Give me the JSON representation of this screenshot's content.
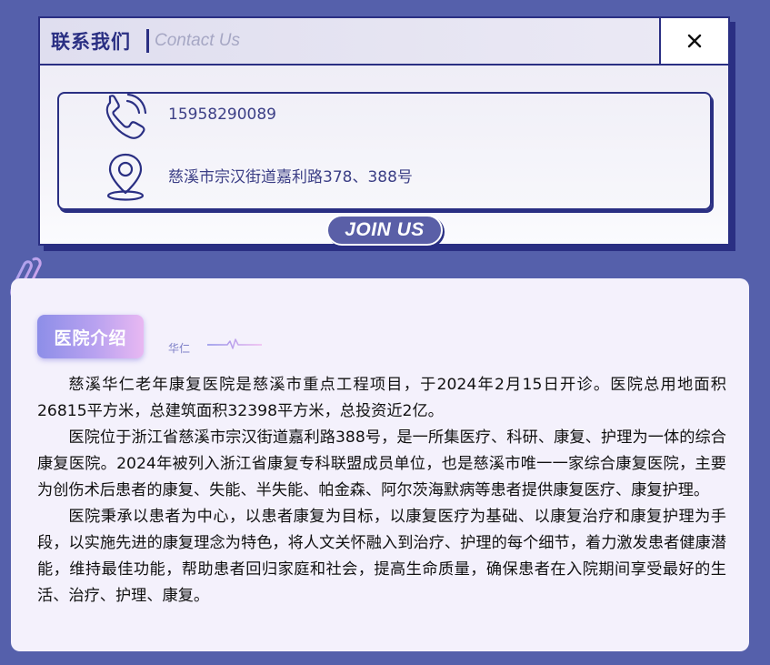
{
  "contact": {
    "title": "联系我们",
    "subtitle": "Contact Us",
    "close_label": "×",
    "phone": "15958290089",
    "address": "慈溪市宗汉街道嘉利路378、388号",
    "join_label": "JOIN US"
  },
  "intro": {
    "badge": "医院介绍",
    "small_label": "华仁",
    "paragraphs": [
      "慈溪华仁老年康复医院是慈溪市重点工程项目，于2024年2月15日开诊。医院总用地面积26815平方米，总建筑面积32398平方米，总投资近2亿。",
      "医院位于浙江省慈溪市宗汉街道嘉利路388号，是一所集医疗、科研、康复、护理为一体的综合康复医院。2024年被列入浙江省康复专科联盟成员单位，也是慈溪市唯一一家综合康复医院，主要为创伤术后患者的康复、失能、半失能、帕金森、阿尔茨海默病等患者提供康复医疗、康复护理。",
      "医院秉承以患者为中心，以患者康复为目标，以康复医疗为基础、以康复治疗和康复护理为手段，以实施先进的康复理念为特色，将人文关怀融入到治疗、护理的每个细节，着力激发患者健康潜能，维持最佳功能，帮助患者回归家庭和社会，提高生命质量，确保患者在入院期间享受最好的生活、治疗、护理、康复。"
    ]
  },
  "icons": {
    "close": "close-icon",
    "phone": "phone-icon",
    "location": "location-pin-icon",
    "paperclip": "paperclip-icon",
    "pulse": "heartbeat-line-icon"
  },
  "colors": {
    "background": "#5560ab",
    "navy": "#2a2f83",
    "card": "#f4f1fc",
    "badge_start": "#8d8ee8",
    "badge_end": "#e8b8f2"
  }
}
